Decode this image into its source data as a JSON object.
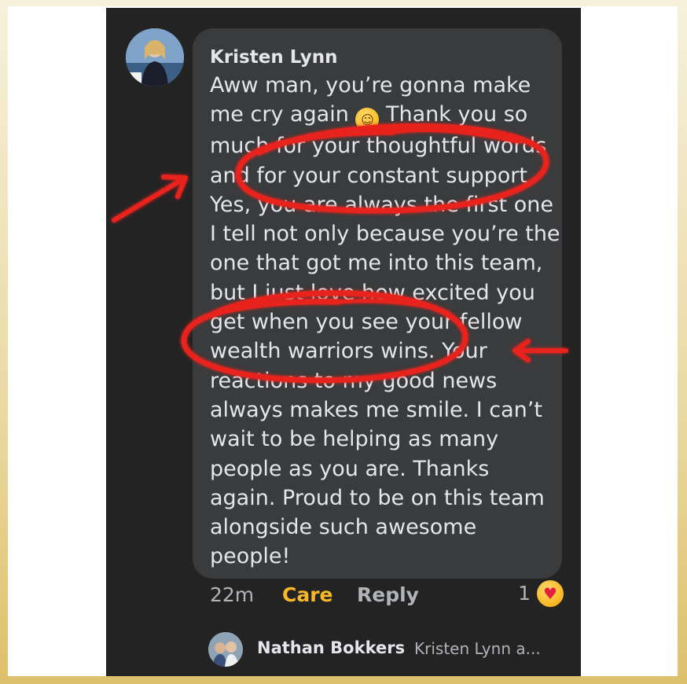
{
  "comment": {
    "author": "Kristen Lynn",
    "lines": [
      "Aww man, you’re gonna make",
      "me cry again",
      "much for your thoughtful words",
      "and for your constant support.",
      "Yes, you are always the first one",
      "I tell not only because you’re the",
      "one that got me into this team,",
      "but I just love how excited you",
      "get when you see your fellow",
      "wealth warriors wins. Your",
      "reactions to my good news",
      "always makes me smile. I can’t",
      "wait to be helping as many",
      "people as you are. Thanks",
      "again. Proud to be on this team",
      "alongside such awesome",
      "people!"
    ],
    "line2_suffix": " Thank you so",
    "emoji": "smiling-face-emoji"
  },
  "actions": {
    "time": "22m",
    "care_label": "Care",
    "reply_label": "Reply",
    "reaction_count": "1",
    "reaction_icon": "care-reaction-icon"
  },
  "reply_preview": {
    "name": "Nathan Bokkers",
    "text": "Kristen Lynn a..."
  },
  "colors": {
    "screen_bg": "#232324",
    "bubble_bg": "#3a3b3c",
    "text": "#e4e6eb",
    "muted": "#b0b3b8",
    "care": "#f7b928",
    "annotation_red": "#e8221f"
  }
}
